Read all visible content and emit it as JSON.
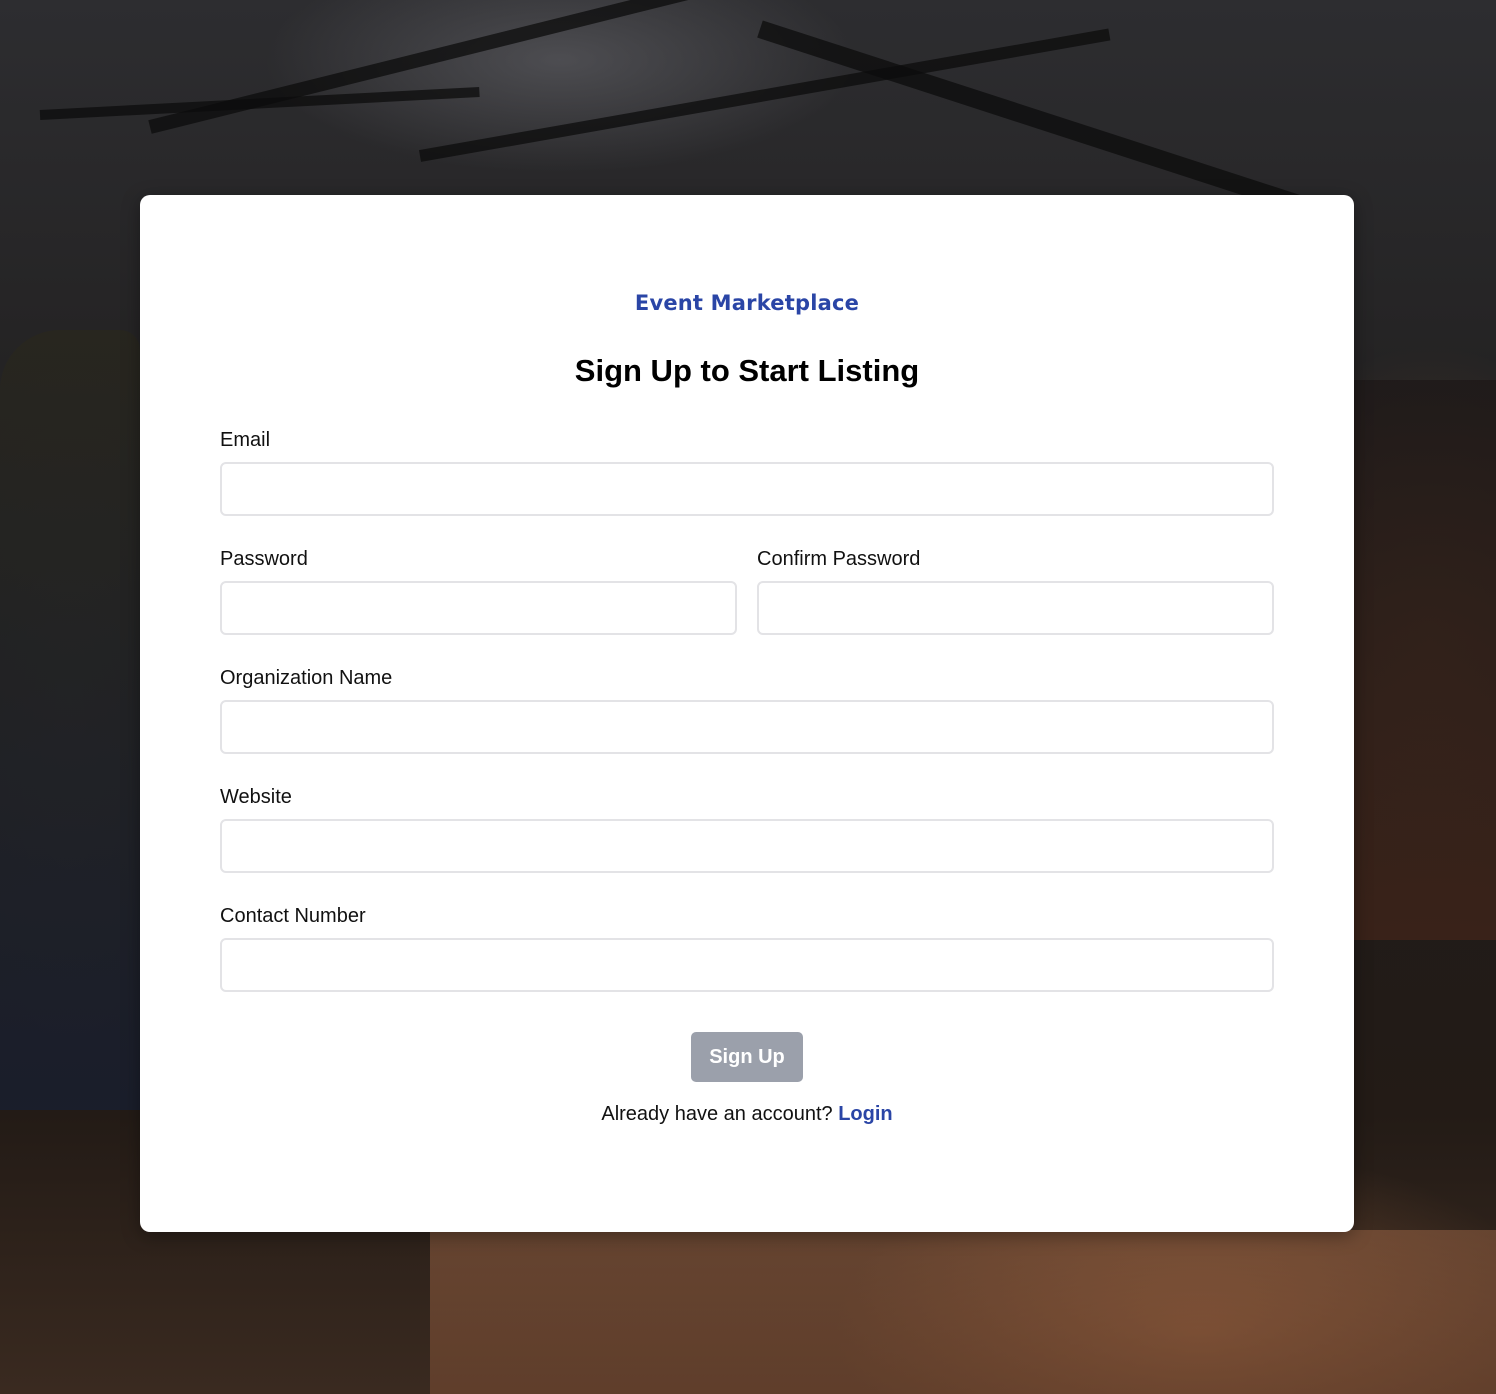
{
  "brand": "Event Marketplace",
  "title": "Sign Up to Start Listing",
  "fields": {
    "email": {
      "label": "Email",
      "value": "",
      "placeholder": ""
    },
    "password": {
      "label": "Password",
      "value": "",
      "placeholder": ""
    },
    "confirm_password": {
      "label": "Confirm Password",
      "value": "",
      "placeholder": ""
    },
    "organization_name": {
      "label": "Organization Name",
      "value": "",
      "placeholder": ""
    },
    "website": {
      "label": "Website",
      "value": "",
      "placeholder": ""
    },
    "contact_number": {
      "label": "Contact Number",
      "value": "",
      "placeholder": ""
    }
  },
  "submit_label": "Sign Up",
  "footer": {
    "prompt": "Already have an account?",
    "login_link": "Login"
  },
  "colors": {
    "brand": "#2a45a6",
    "button_disabled": "#9ba0ab",
    "input_border": "#e3e3e6"
  }
}
